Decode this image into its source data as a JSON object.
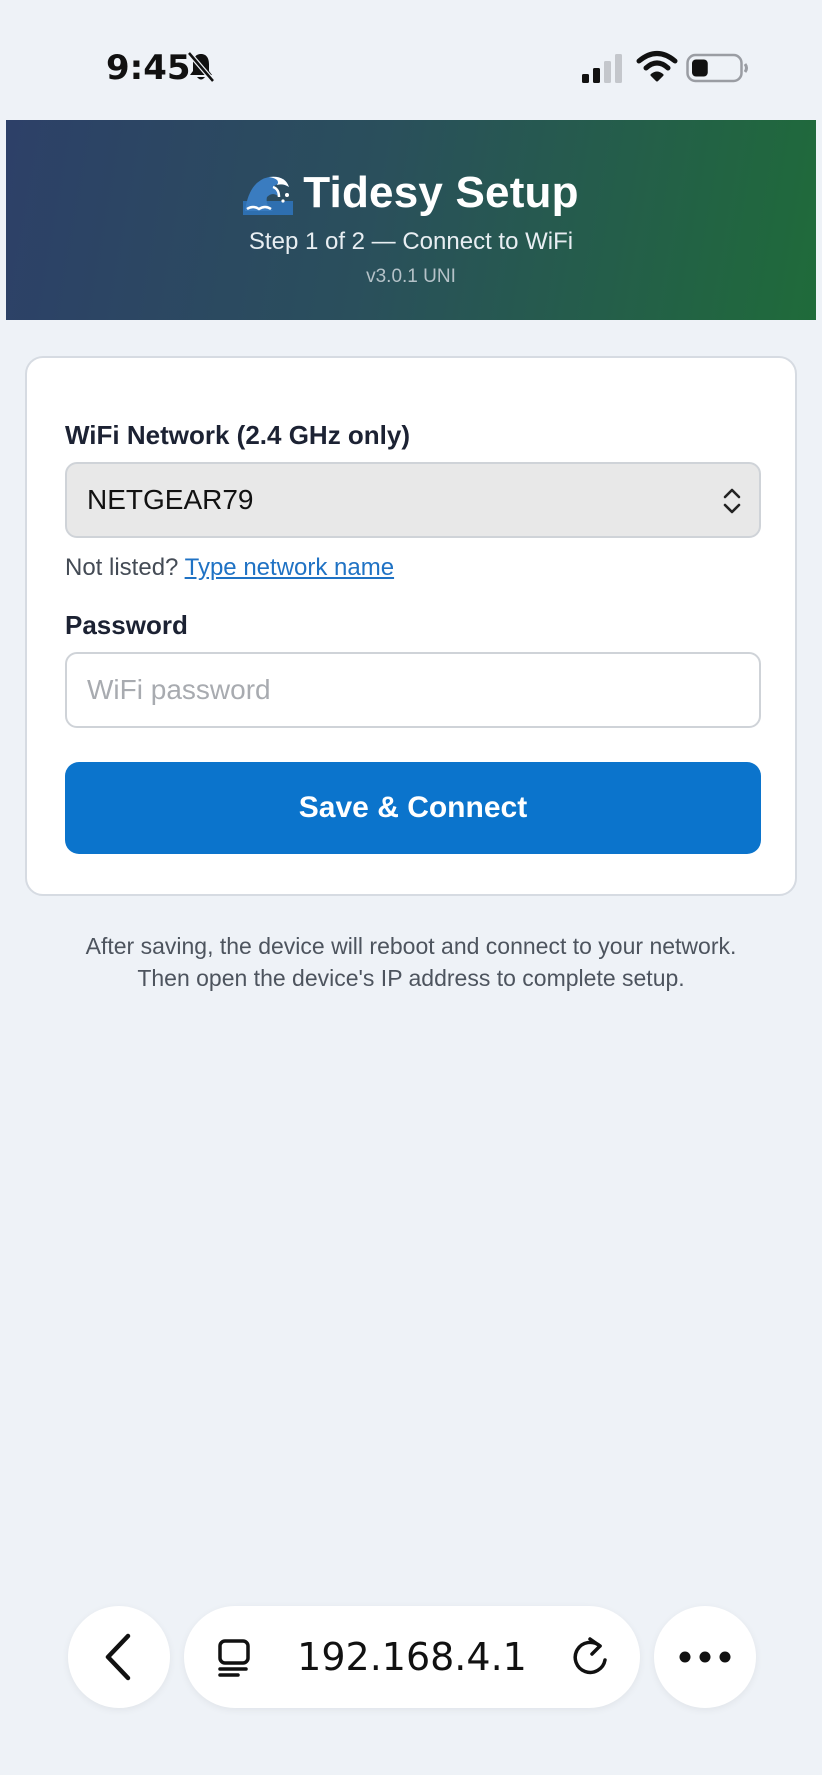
{
  "status_bar": {
    "time": "9:45",
    "icons": [
      "bell-slash-icon",
      "cellular-signal-icon",
      "wifi-icon",
      "battery-icon"
    ],
    "battery_level": 0.35
  },
  "header": {
    "icon": "wave-emoji-icon",
    "title": "Tidesy Setup",
    "subtitle": "Step 1 of 2 — Connect to WiFi",
    "version": "v3.0.1 UNI"
  },
  "form": {
    "network_label": "WiFi Network (2.4 GHz only)",
    "network_selected": "NETGEAR79",
    "not_listed_text": "Not listed?",
    "type_network_link": "Type network name",
    "password_label": "Password",
    "password_value": "",
    "password_placeholder": "WiFi password",
    "save_button": "Save & Connect"
  },
  "footnote": {
    "line1": "After saving, the device will reboot and connect to your network.",
    "line2": "Then open the device's IP address to complete setup."
  },
  "browser": {
    "url": "192.168.4.1",
    "icons": [
      "back-chevron-icon",
      "tabs-icon",
      "reload-icon",
      "more-icon"
    ]
  },
  "colors": {
    "background": "#eef2f7",
    "header_gradient_start": "#2d4068",
    "header_gradient_end": "#1f6b3a",
    "primary_button": "#0b74cc",
    "link": "#1f72c4"
  }
}
